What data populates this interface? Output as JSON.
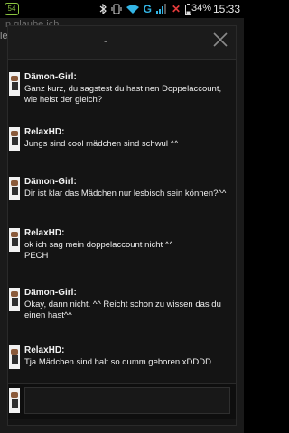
{
  "status_bar": {
    "badge": "54",
    "network_label": "G",
    "battery_percent": "34%",
    "time": "15:33",
    "icons": [
      "bluetooth-icon",
      "vibrate-icon",
      "wifi-icon",
      "signal-icon",
      "no-sim-icon",
      "battery-icon"
    ]
  },
  "background": {
    "line1": "n glaube ich",
    "line2": "le"
  },
  "dialog": {
    "title": "-",
    "messages": [
      {
        "sender": "Dämon-Girl:",
        "lines": [
          "Ganz kurz, du sagstest du hast nen Doppelaccount,",
          "wie heist der gleich?"
        ]
      },
      {
        "sender": "RelaxHD:",
        "lines": [
          "Jungs sind cool mädchen sind schwul ^^"
        ]
      },
      {
        "sender": "Dämon-Girl:",
        "lines": [
          "Dir ist klar das Mädchen nur lesbisch sein können?^^"
        ]
      },
      {
        "sender": "RelaxHD:",
        "lines": [
          "ok ich sag mein doppelaccount nicht ^^",
          "PECH"
        ]
      },
      {
        "sender": "Dämon-Girl:",
        "lines": [
          "Okay, dann nicht. ^^ Reicht schon zu wissen das du",
          "einen hast^^"
        ]
      },
      {
        "sender": "RelaxHD:",
        "lines": [
          "Tja Mädchen sind halt so dumm geboren xDDDD"
        ]
      }
    ],
    "input": {
      "value": "",
      "placeholder": ""
    }
  }
}
